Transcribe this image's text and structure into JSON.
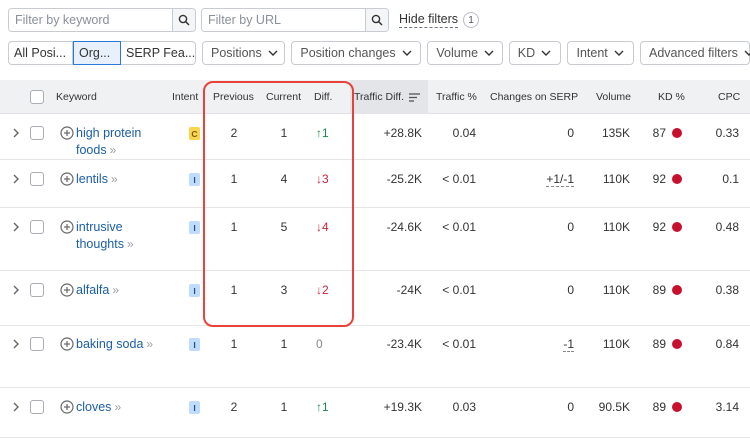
{
  "filters": {
    "keyword_placeholder": "Filter by keyword",
    "url_placeholder": "Filter by URL",
    "hide_filters_label": "Hide filters",
    "hide_filters_count": "1"
  },
  "tabs": [
    {
      "label": "All Posi..."
    },
    {
      "label": "Org..."
    },
    {
      "label": "SERP Fea..."
    }
  ],
  "dropdowns": [
    {
      "label": "Positions"
    },
    {
      "label": "Position changes"
    },
    {
      "label": "Volume"
    },
    {
      "label": "KD"
    },
    {
      "label": "Intent"
    },
    {
      "label": "Advanced filters"
    }
  ],
  "columns": {
    "keyword": "Keyword",
    "intent": "Intent",
    "previous": "Previous",
    "current": "Current",
    "diff": "Diff.",
    "traffic_diff": "Traffic Diff.",
    "traffic_pct": "Traffic %",
    "changes_serp": "Changes on SERP",
    "volume": "Volume",
    "kd": "KD %",
    "cpc": "CPC"
  },
  "rows": [
    {
      "kw_line1": "high protein",
      "kw_line2": "foods",
      "intent": "C",
      "previous": "2",
      "current": "1",
      "diff": "↑1",
      "traffic_diff": "+28.8K",
      "traffic_pct": "0.04",
      "serp": "0",
      "volume": "135K",
      "kd": "87",
      "cpc": "0.33"
    },
    {
      "kw_line1": "lentils",
      "kw_line2": "",
      "intent": "I",
      "previous": "1",
      "current": "4",
      "diff": "↓3",
      "traffic_diff": "-25.2K",
      "traffic_pct": "< 0.01",
      "serp": "+1/-1",
      "volume": "110K",
      "kd": "92",
      "cpc": "0.1"
    },
    {
      "kw_line1": "intrusive",
      "kw_line2": "thoughts",
      "intent": "I",
      "previous": "1",
      "current": "5",
      "diff": "↓4",
      "traffic_diff": "-24.6K",
      "traffic_pct": "< 0.01",
      "serp": "0",
      "volume": "110K",
      "kd": "92",
      "cpc": "0.48"
    },
    {
      "kw_line1": "alfalfa",
      "kw_line2": "",
      "intent": "I",
      "previous": "1",
      "current": "3",
      "diff": "↓2",
      "traffic_diff": "-24K",
      "traffic_pct": "< 0.01",
      "serp": "0",
      "volume": "110K",
      "kd": "89",
      "cpc": "0.38"
    },
    {
      "kw_line1": "baking soda",
      "kw_line2": "",
      "intent": "I",
      "previous": "1",
      "current": "1",
      "diff": "0",
      "traffic_diff": "-23.4K",
      "traffic_pct": "< 0.01",
      "serp": "-1",
      "volume": "110K",
      "kd": "89",
      "cpc": "0.84"
    },
    {
      "kw_line1": "cloves",
      "kw_line2": "",
      "intent": "I",
      "previous": "2",
      "current": "1",
      "diff": "↑1",
      "traffic_diff": "+19.3K",
      "traffic_pct": "0.03",
      "serp": "0",
      "volume": "90.5K",
      "kd": "89",
      "cpc": "3.14"
    }
  ],
  "colors": {
    "link": "#1b5ea8",
    "up": "#1a8a4a",
    "down": "#c8243c",
    "kd_dot": "#c8102e",
    "highlight": "#e8423a"
  }
}
